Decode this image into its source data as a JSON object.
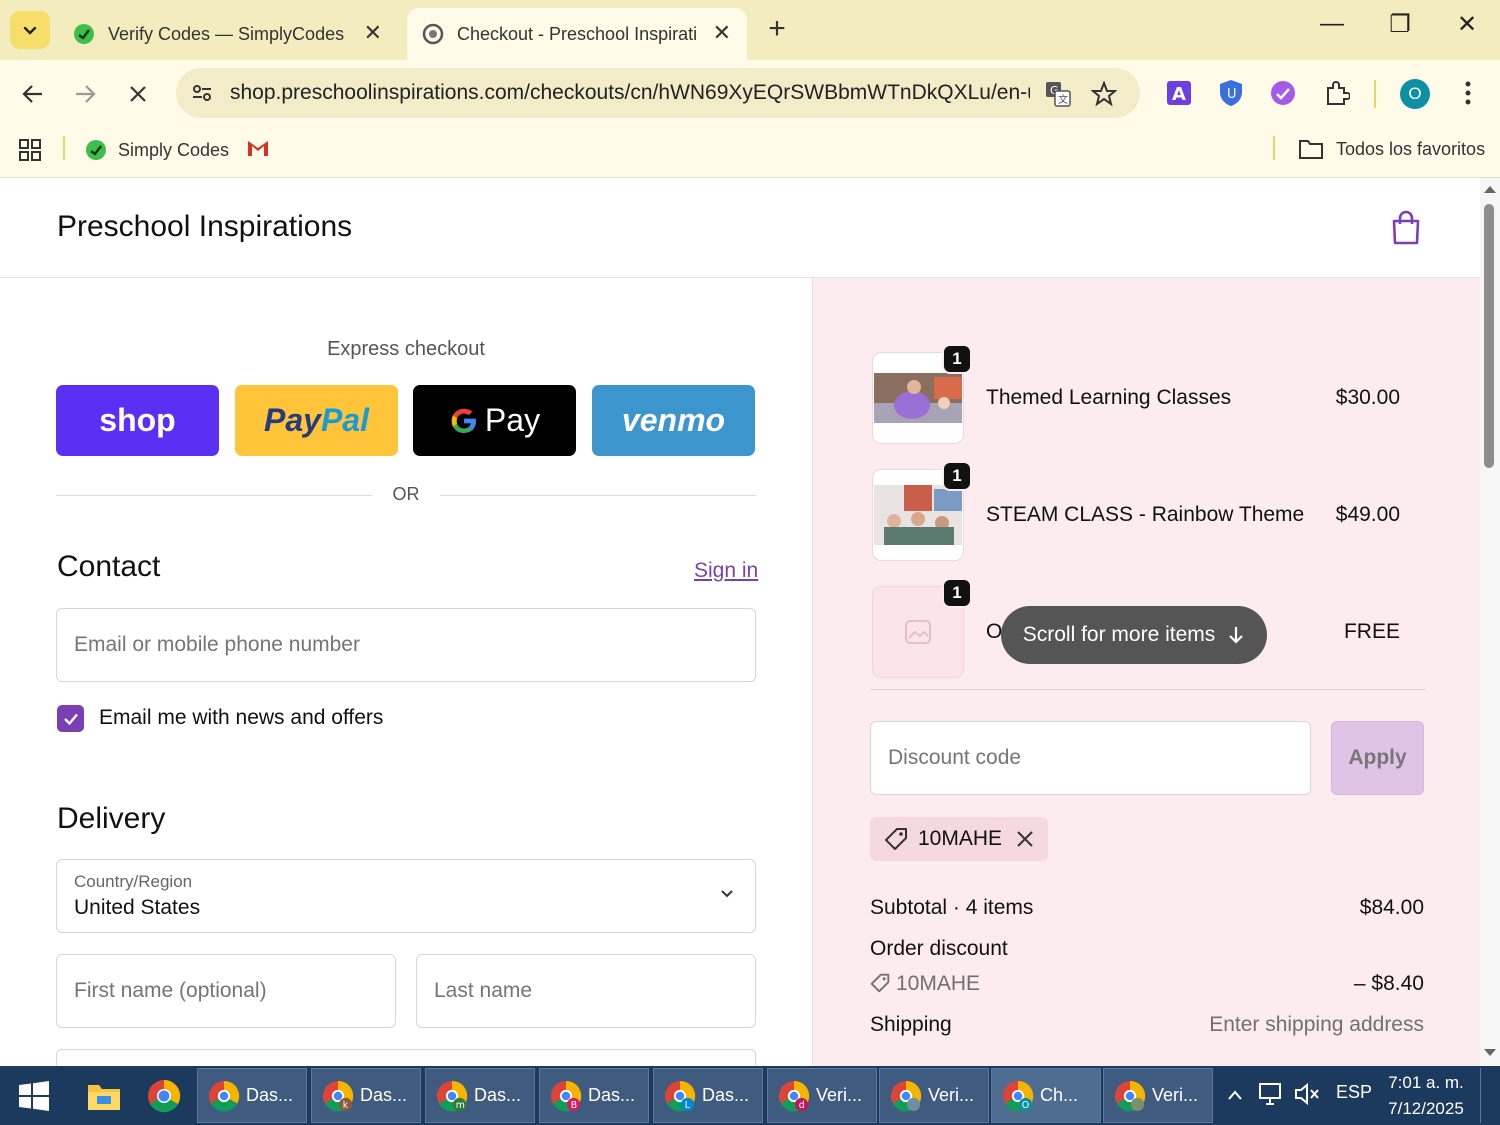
{
  "browser": {
    "tabs": [
      {
        "title": "Verify Codes — SimplyCodes",
        "active": false
      },
      {
        "title": "Checkout - Preschool Inspiratio",
        "active": true
      }
    ],
    "url": "shop.preschoolinspirations.com/checkouts/cn/hWN69XyEQrSWBbmWTnDkQXLu/en-u...",
    "profile_initial": "O",
    "bookmarks": [
      {
        "label": "Simply Codes"
      }
    ],
    "all_bookmarks_label": "Todos los favoritos"
  },
  "page": {
    "brand": "Preschool Inspirations",
    "express_checkout_label": "Express checkout",
    "express_buttons": {
      "shop": "shop",
      "paypal_pay": "Pay",
      "paypal_pal": "Pal",
      "gpay": "Pay",
      "venmo": "venmo"
    },
    "or_label": "OR",
    "contact": {
      "title": "Contact",
      "sign_in": "Sign in",
      "email_placeholder": "Email or mobile phone number",
      "newsletter_label": "Email me with news and offers",
      "newsletter_checked": true
    },
    "delivery": {
      "title": "Delivery",
      "country_label": "Country/Region",
      "country_value": "United States",
      "first_name_placeholder": "First name (optional)",
      "last_name_placeholder": "Last name"
    }
  },
  "summary": {
    "items": [
      {
        "qty": "1",
        "name": "Themed Learning Classes",
        "price": "$30.00"
      },
      {
        "qty": "1",
        "name": "STEAM CLASS - Rainbow Theme",
        "price": "$49.00"
      },
      {
        "qty": "1",
        "name": "O",
        "price": "FREE"
      }
    ],
    "scroll_hint": "Scroll for more items",
    "discount_placeholder": "Discount code",
    "apply_label": "Apply",
    "applied_code": "10MAHE",
    "subtotal_label": "Subtotal · 4 items",
    "subtotal_value": "$84.00",
    "order_discount_label": "Order discount",
    "discount_code": "10MAHE",
    "discount_value": "– $8.40",
    "shipping_label": "Shipping",
    "shipping_value": "Enter shipping address"
  },
  "taskbar": {
    "apps": [
      {
        "label": "Das...",
        "badge": ""
      },
      {
        "label": "Das...",
        "badge": "k"
      },
      {
        "label": "Das...",
        "badge": "m"
      },
      {
        "label": "Das...",
        "badge": "B"
      },
      {
        "label": "Das...",
        "badge": "L"
      },
      {
        "label": "Veri...",
        "badge": "d"
      },
      {
        "label": "Veri...",
        "badge": ""
      },
      {
        "label": "Ch...",
        "badge": "O"
      },
      {
        "label": "Veri...",
        "badge": ""
      }
    ],
    "language": "ESP",
    "time": "7:01 a. m.",
    "date": "7/12/2025"
  },
  "colors": {
    "accent_purple": "#7b3fb5",
    "shop_pay": "#5a31f4",
    "paypal": "#ffc439",
    "venmo": "#3d95ce",
    "summary_bg": "#fcecf0",
    "apply_bg": "#e0c3e7"
  }
}
